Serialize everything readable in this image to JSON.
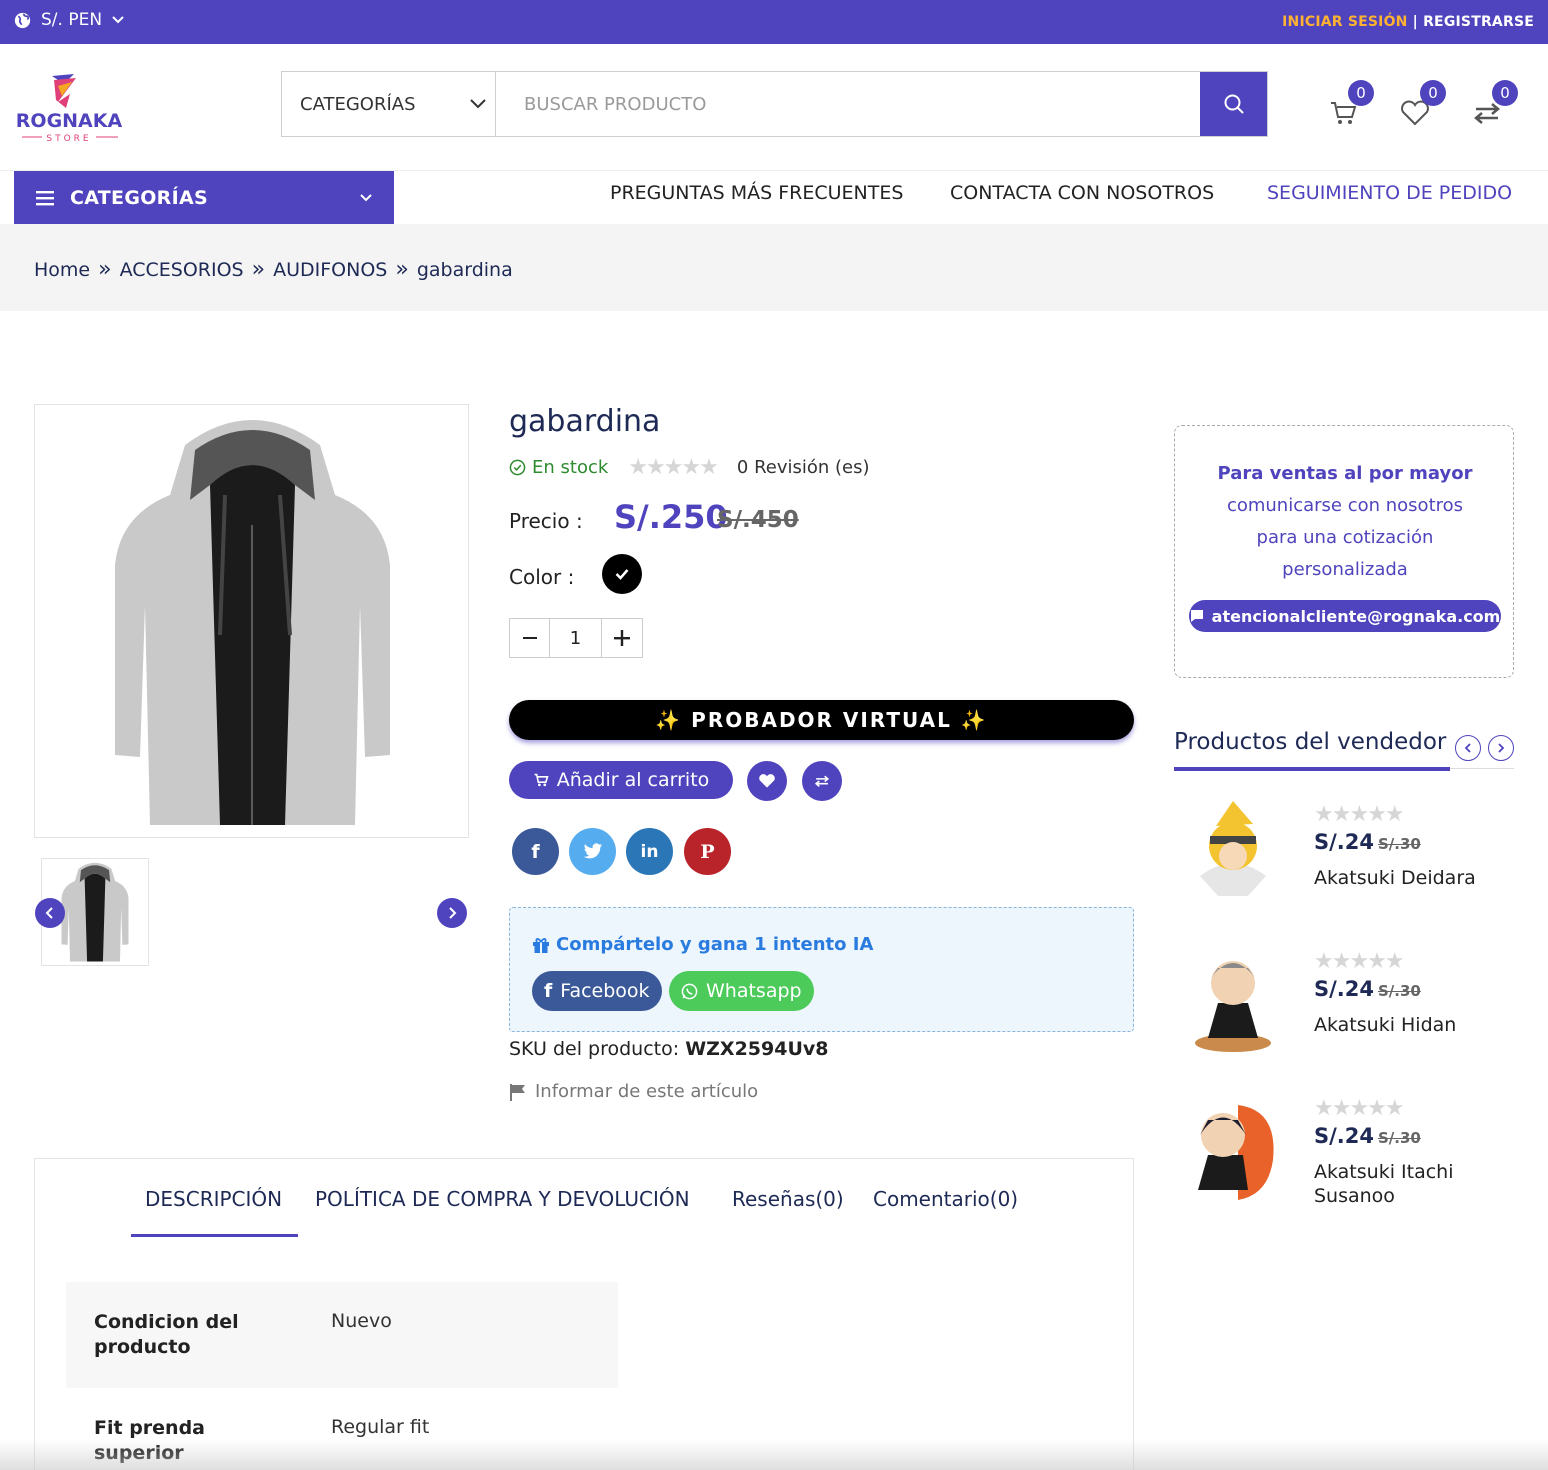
{
  "topbar": {
    "currency": "S/. PEN",
    "login": "INICIAR SESIÓN",
    "separator": "|",
    "register": "REGISTRARSE"
  },
  "header": {
    "logo_text": "ROGNAKA",
    "logo_sub": "STORE",
    "search_category": "CATEGORÍAS",
    "search_placeholder": "BUSCAR PRODUCTO",
    "cart_count": "0",
    "wishlist_count": "0",
    "compare_count": "0"
  },
  "nav": {
    "categories": "CATEGORÍAS",
    "items": [
      "PREGUNTAS MÁS FRECUENTES",
      "CONTACTA CON NOSOTROS",
      "SEGUIMIENTO DE PEDIDO"
    ]
  },
  "breadcrumb": [
    "Home",
    "ACCESORIOS",
    "AUDIFONOS",
    "gabardina"
  ],
  "product": {
    "title": "gabardina",
    "stock": "En stock",
    "reviews": "0 Revisión (es)",
    "price_label": "Precio :",
    "price": "S/.250",
    "old_price": "S/.450",
    "color_label": "Color :",
    "quantity": "1",
    "probador": "✨ PROBADOR VIRTUAL ✨",
    "add_to_cart": "Añadir al carrito",
    "share_heading": "Compártelo y gana 1 intento IA",
    "share_facebook": "Facebook",
    "share_whatsapp": "Whatsapp",
    "sku_label": "SKU del producto:",
    "sku": "WZX2594Uv8",
    "report": "Informar de este artículo"
  },
  "tabs": [
    "DESCRIPCIÓN",
    "POLÍTICA DE COMPRA Y DEVOLUCIÓN",
    "Reseñas(0)",
    "Comentario(0)"
  ],
  "specs": [
    {
      "key_line1": "Condicion del",
      "key_line2": "producto",
      "value": "Nuevo"
    },
    {
      "key_line1": "Fit prenda",
      "key_line2": "superior",
      "value": "Regular fit"
    }
  ],
  "wholesale": {
    "bold": "Para ventas al por mayor",
    "text": "comunicarse con nosotros para una cotización personalizada",
    "email": "atencionalcliente@rognaka.com"
  },
  "vendor": {
    "title": "Productos del vendedor",
    "products": [
      {
        "price": "S/.24",
        "old_price": "S/.30",
        "name": "Akatsuki Deidara"
      },
      {
        "price": "S/.24",
        "old_price": "S/.30",
        "name": "Akatsuki Hidan"
      },
      {
        "price": "S/.24",
        "old_price": "S/.30",
        "name": "Akatsuki Itachi Susanoo"
      }
    ]
  },
  "colors": {
    "accent": "#4f44bd",
    "login": "#ffb232",
    "stock": "#2e8b2e",
    "facebook": "#3b5998",
    "twitter": "#55acee",
    "linkedin": "#2b76b6",
    "pinterest": "#b8242a",
    "whatsapp": "#4cca5a"
  }
}
